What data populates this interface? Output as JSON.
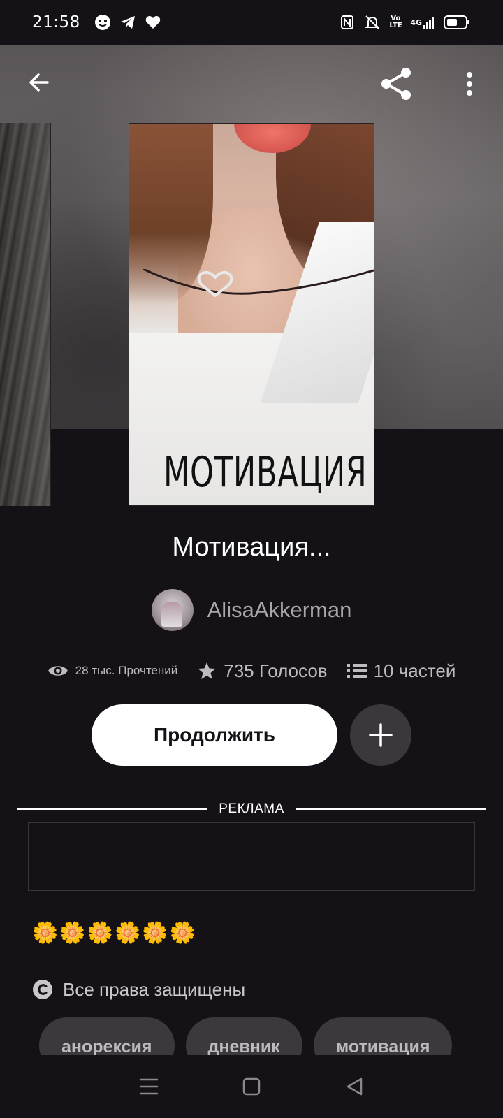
{
  "status_bar": {
    "time": "21:58",
    "left_icons": [
      "face-icon",
      "telegram-icon",
      "heart-icon"
    ],
    "right_icons": [
      "nfc-icon",
      "mute-icon",
      "volte-icon",
      "signal-4g-icon",
      "battery-icon"
    ],
    "volte_label": "Vo LTE",
    "network_label": "4G"
  },
  "header": {
    "back_icon": "arrow-left-icon",
    "share_icon": "share-icon",
    "more_icon": "more-vertical-icon"
  },
  "cover": {
    "title_text": "МОТИВАЦИЯ"
  },
  "story": {
    "title": "Мотивация...",
    "author": "AlisaAkkerman",
    "stats": {
      "reads": "28 тыс. Прочтений",
      "votes": "735 Голосов",
      "parts": "10 частей"
    },
    "continue_label": "Продолжить",
    "add_icon": "plus-icon"
  },
  "ad": {
    "label": "РЕКЛАМА"
  },
  "description": {
    "text": "🌼🌼🌼🌼🌼🌼",
    "copyright": "Все права защищены"
  },
  "tags": [
    "анорексия",
    "дневник",
    "мотивация"
  ],
  "nav": {
    "recents_icon": "menu-icon",
    "home_icon": "square-icon",
    "back_icon": "triangle-back-icon"
  },
  "colors": {
    "background": "#141216",
    "button_bg": "#ffffff",
    "chip_bg": "#3b393d",
    "muted_text": "#a8a6aa"
  }
}
